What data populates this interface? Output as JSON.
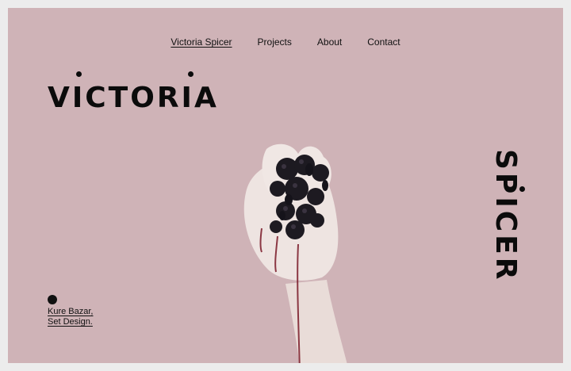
{
  "nav": {
    "brand": "Victoria Spicer",
    "items": [
      "Projects",
      "About",
      "Contact"
    ]
  },
  "hero": {
    "title_left": "VICTORIA",
    "title_right": "SPICER"
  },
  "credit": {
    "line1": "Kure Bazar,",
    "line2": "Set Design."
  },
  "colors": {
    "background": "#cfb3b7",
    "text": "#0b0b0b"
  },
  "image": {
    "subject": "hand-squeezing-blackberries"
  }
}
